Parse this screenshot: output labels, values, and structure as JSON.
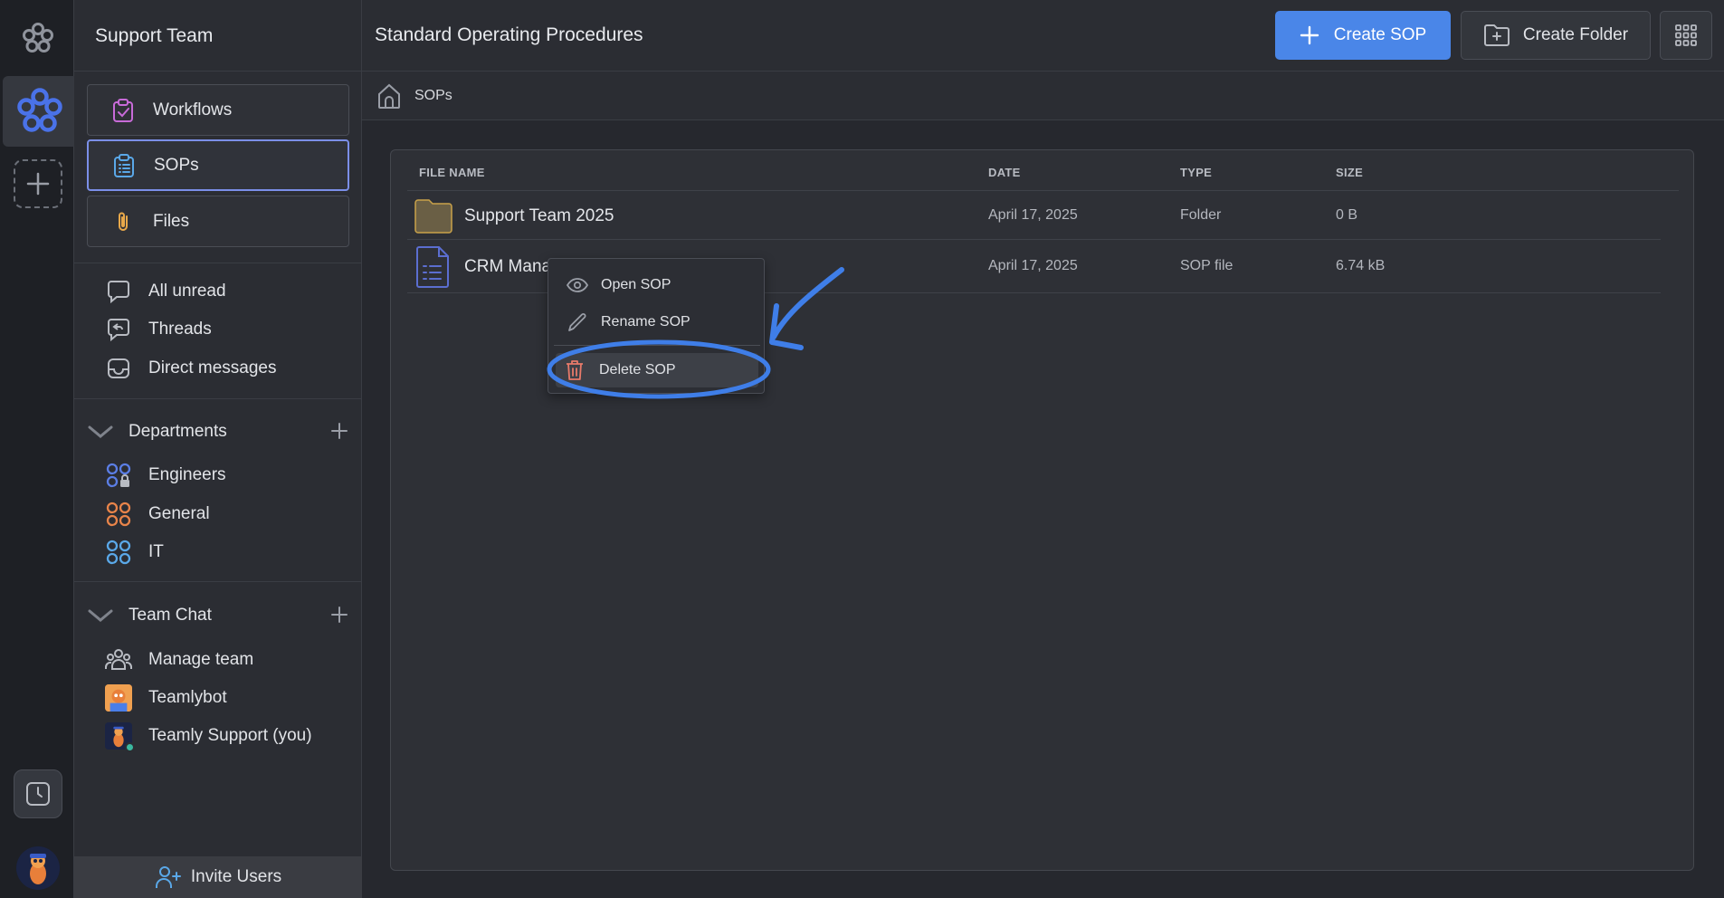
{
  "sidebar": {
    "workspace_title": "Support Team",
    "nav": [
      {
        "label": "Workflows"
      },
      {
        "label": "SOPs"
      },
      {
        "label": "Files"
      }
    ],
    "inbox": [
      {
        "label": "All unread"
      },
      {
        "label": "Threads"
      },
      {
        "label": "Direct messages"
      }
    ],
    "departments": {
      "title": "Departments",
      "items": [
        {
          "label": "Engineers",
          "color": "#5b7ee5"
        },
        {
          "label": "General",
          "color": "#e8844a"
        },
        {
          "label": "IT",
          "color": "#5aa8e8"
        }
      ]
    },
    "team_chat": {
      "title": "Team Chat",
      "items": [
        {
          "label": "Manage team"
        },
        {
          "label": "Teamlybot"
        },
        {
          "label": "Teamly Support (you)"
        }
      ]
    },
    "invite_label": "Invite Users"
  },
  "header": {
    "title": "Standard Operating Procedures",
    "create_sop_label": "Create SOP",
    "create_folder_label": "Create Folder"
  },
  "breadcrumb": {
    "current": "SOPs"
  },
  "table": {
    "columns": [
      "FILE NAME",
      "DATE",
      "TYPE",
      "SIZE"
    ],
    "rows": [
      {
        "name": "Support Team 2025",
        "date": "April 17, 2025",
        "type": "Folder",
        "size": "0 B"
      },
      {
        "name": "CRM Mana",
        "date": "April 17, 2025",
        "type": "SOP file",
        "size": "6.74 kB"
      }
    ]
  },
  "context_menu": {
    "items": [
      {
        "label": "Open SOP"
      },
      {
        "label": "Rename SOP"
      },
      {
        "label": "Delete SOP"
      }
    ]
  },
  "colors": {
    "accent": "#4a86e8",
    "annotation": "#3f7ee8",
    "delete": "#e87a6a",
    "folder": "#6a5f45"
  }
}
